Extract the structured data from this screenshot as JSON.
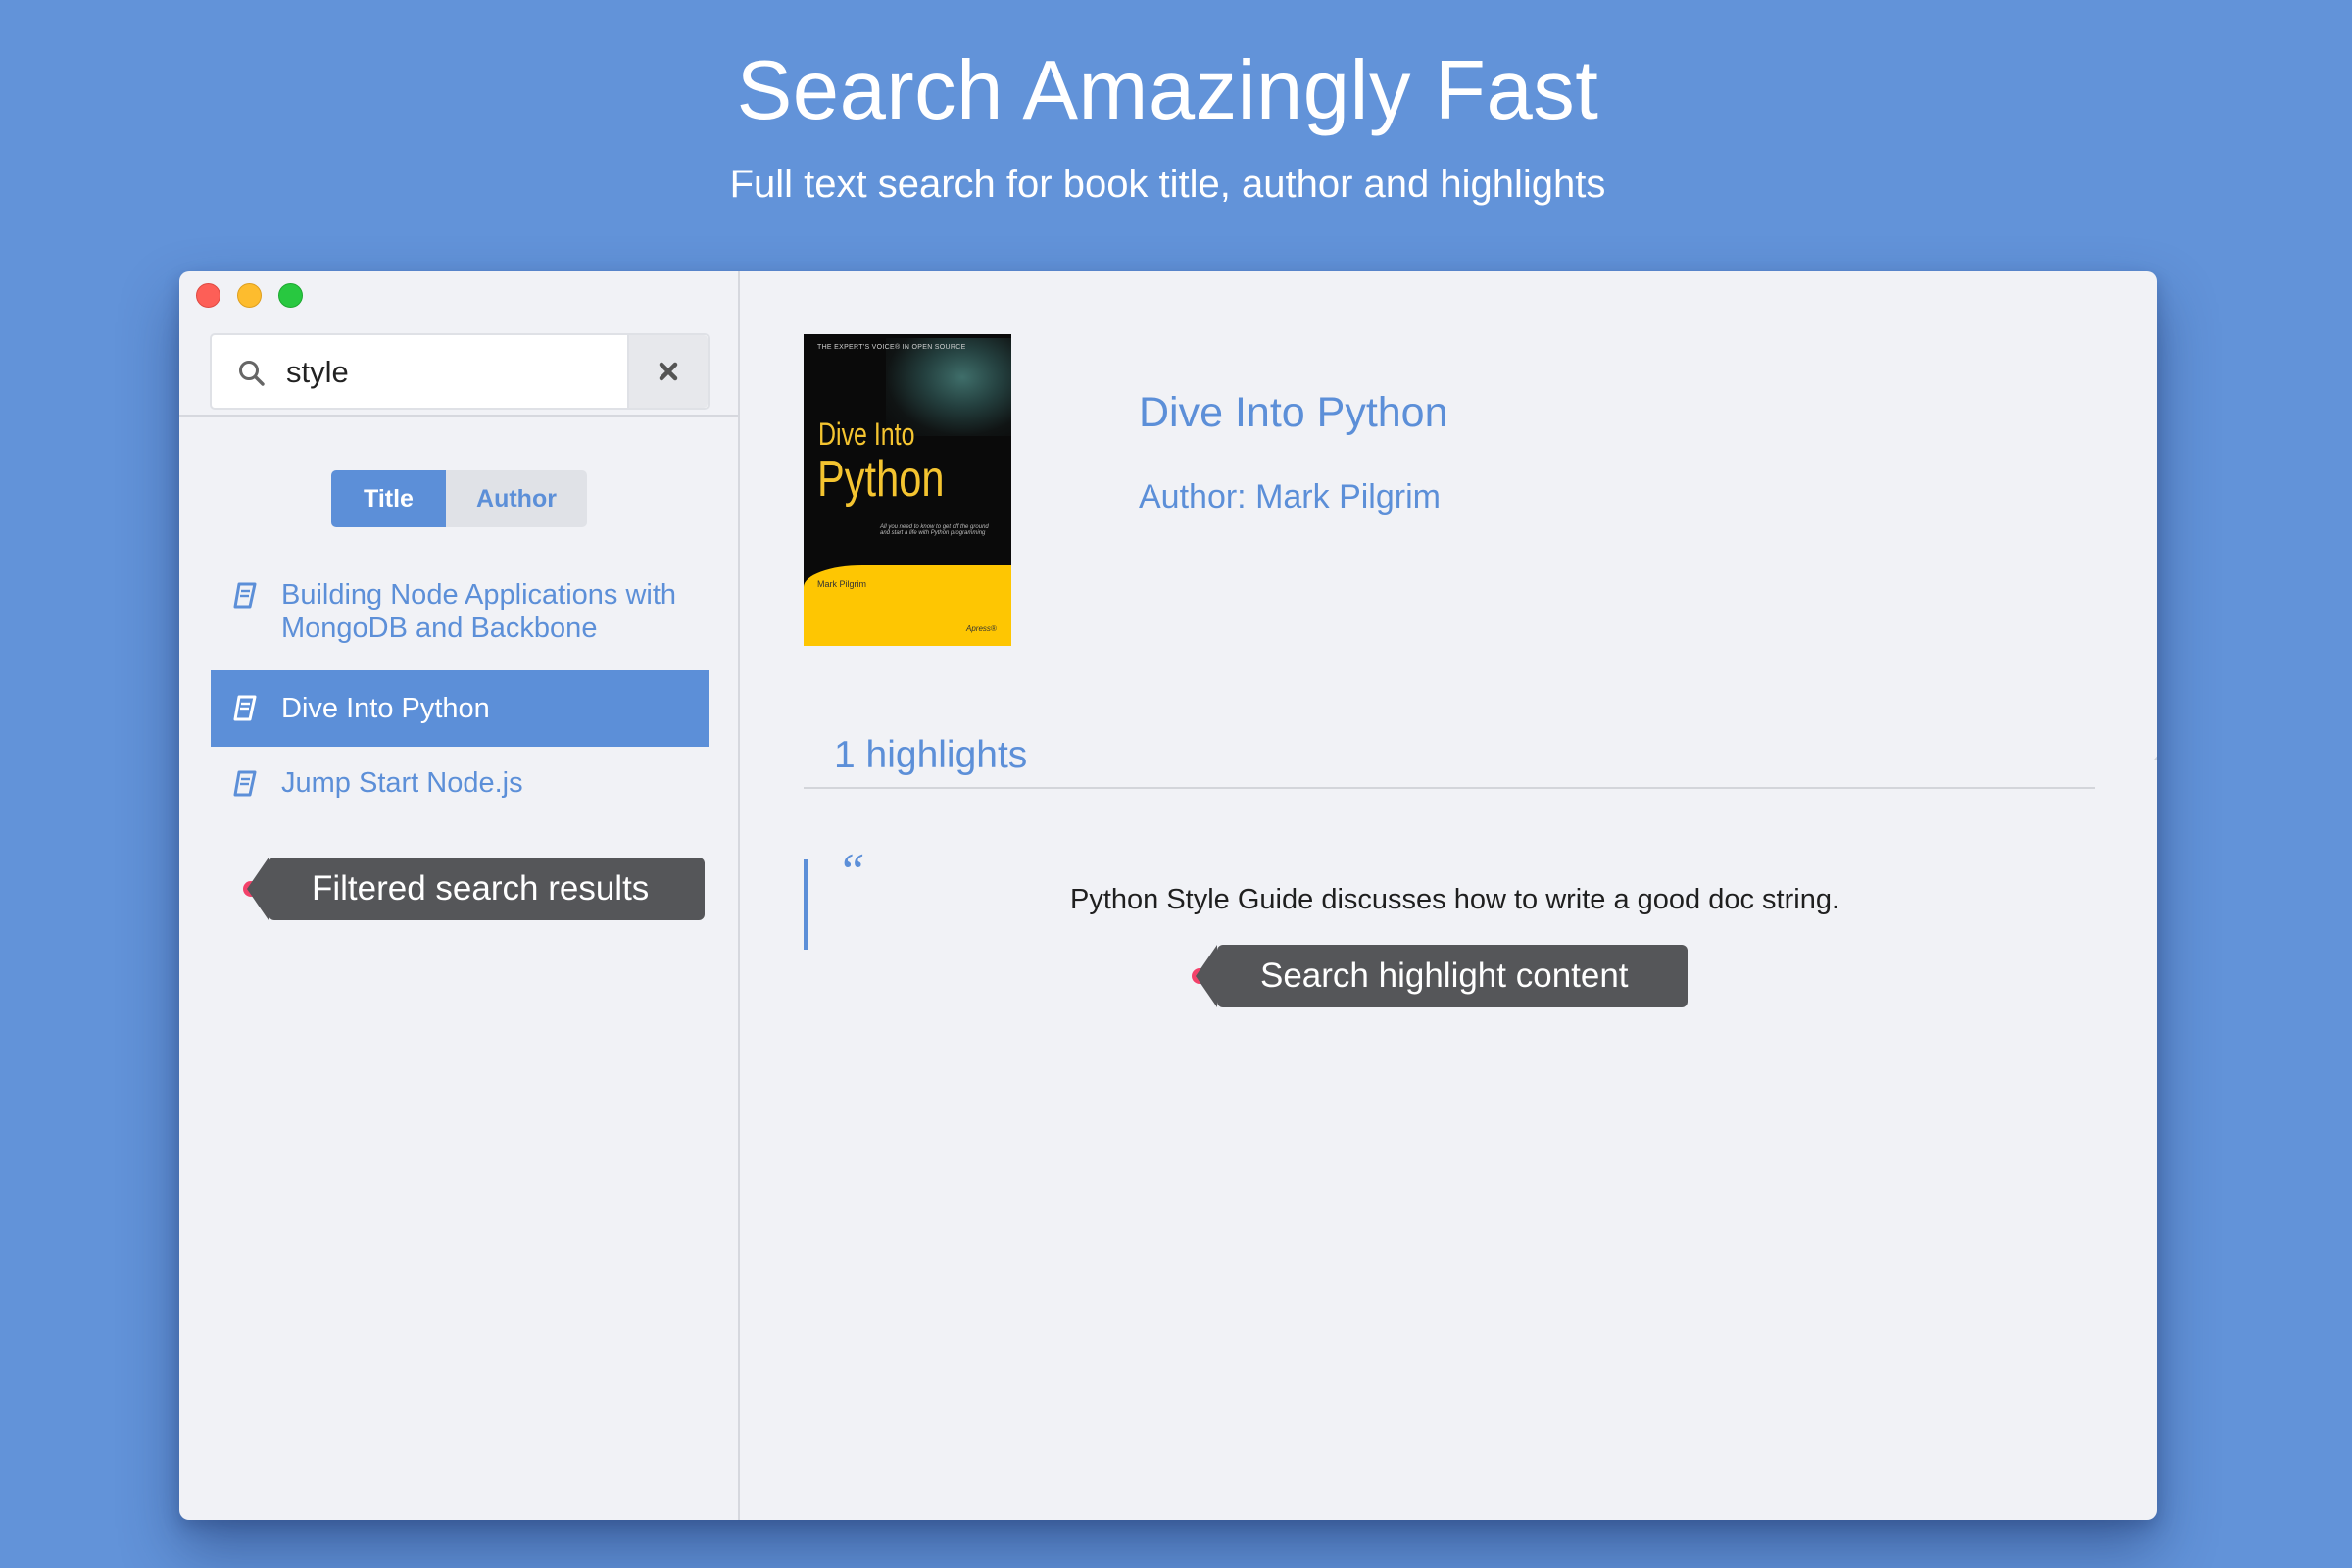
{
  "hero": {
    "title": "Search Amazingly Fast",
    "subtitle": "Full text search for book title, author and highlights"
  },
  "search": {
    "value": "style",
    "placeholder": ""
  },
  "filter_tabs": [
    {
      "label": "Title",
      "active": true
    },
    {
      "label": "Author",
      "active": false
    }
  ],
  "results": [
    {
      "title": "Building Node Applications with MongoDB and Backbone",
      "selected": false
    },
    {
      "title": "Dive Into Python",
      "selected": true
    },
    {
      "title": "Jump Start Node.js",
      "selected": false
    }
  ],
  "annotations": {
    "filtered": "Filtered search results",
    "highlight": "Search highlight content"
  },
  "book": {
    "title": "Dive Into Python",
    "author": "Author: Mark Pilgrim",
    "cover": {
      "series": "THE EXPERT'S VOICE® IN OPEN SOURCE",
      "line1": "Dive Into",
      "line2": "Python",
      "tagline": "All you need to know to get off the ground and start a life with Python programming",
      "author": "Mark Pilgrim",
      "publisher": "Apress®"
    }
  },
  "highlights": {
    "count_label": "1 highlights",
    "items": [
      {
        "text": "Python Style Guide discusses how to write a good doc string."
      }
    ]
  },
  "colors": {
    "background": "#6293d9",
    "accent": "#5c8fd8",
    "window": "#f1f2f6",
    "tooltip": "#555659",
    "tooltip_dot": "#f2426a"
  }
}
